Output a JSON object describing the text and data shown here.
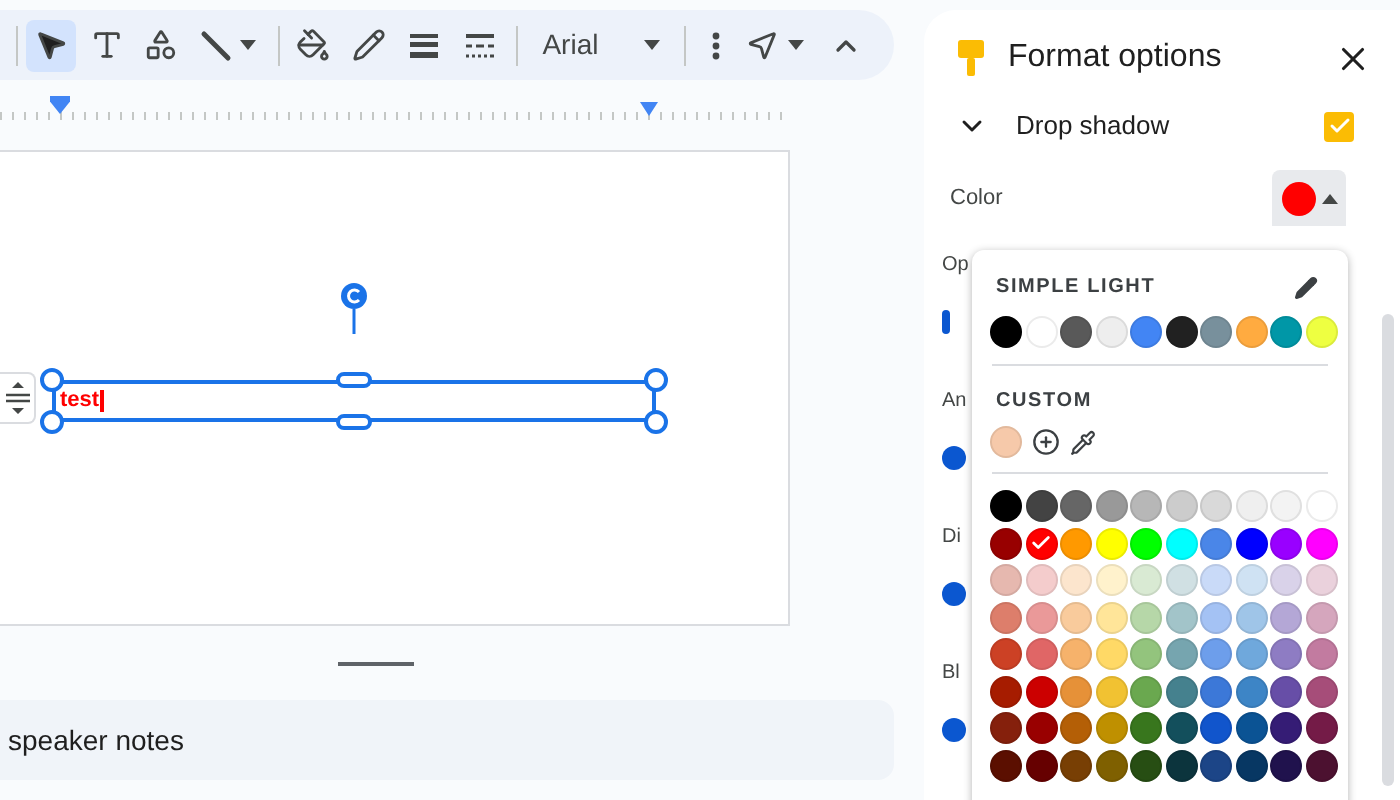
{
  "toolbar": {
    "tools": [
      {
        "kind": "select",
        "selected": true
      },
      {
        "kind": "text",
        "selected": false
      },
      {
        "kind": "shapes",
        "selected": false
      },
      {
        "kind": "line",
        "selected": false
      },
      {
        "kind": "fill",
        "selected": false
      },
      {
        "kind": "pen",
        "selected": false
      },
      {
        "kind": "weight",
        "selected": false
      },
      {
        "kind": "dash",
        "selected": false
      }
    ],
    "font": "Arial"
  },
  "slide": {
    "textbox": "test"
  },
  "notes": "speaker notes",
  "panel": {
    "title": "Format options",
    "section": {
      "label": "Drop shadow",
      "expanded": true,
      "checked": true
    },
    "color_label": "Color",
    "color": "#ff0000",
    "covered_labels": [
      "Op",
      "An",
      "Di",
      "Bl"
    ],
    "popup": {
      "simple_title": "SIMPLE LIGHT",
      "simple": [
        {
          "color": "#000000",
          "selected": false
        },
        {
          "color": "#ffffff",
          "selected": false
        },
        {
          "color": "#595959",
          "selected": false
        },
        {
          "color": "#eeeeee",
          "selected": false
        },
        {
          "color": "#4285f4",
          "selected": false
        },
        {
          "color": "#212121",
          "selected": false
        },
        {
          "color": "#78909c",
          "selected": false
        },
        {
          "color": "#ffab40",
          "selected": false
        },
        {
          "color": "#0097a7",
          "selected": false
        },
        {
          "color": "#eeff41",
          "selected": false
        }
      ],
      "custom_title": "CUSTOM",
      "custom": [
        {
          "color": "#f6c9aa",
          "selected": false
        }
      ],
      "palette": [
        [
          {
            "color": "#000000",
            "selected": false
          },
          {
            "color": "#434343",
            "selected": false
          },
          {
            "color": "#666666",
            "selected": false
          },
          {
            "color": "#999999",
            "selected": false
          },
          {
            "color": "#b7b7b7",
            "selected": false
          },
          {
            "color": "#cccccc",
            "selected": false
          },
          {
            "color": "#d9d9d9",
            "selected": false
          },
          {
            "color": "#efefef",
            "selected": false
          },
          {
            "color": "#f3f3f3",
            "selected": false
          },
          {
            "color": "#ffffff",
            "selected": false
          }
        ],
        [
          {
            "color": "#980000",
            "selected": false
          },
          {
            "color": "#ff0000",
            "selected": true
          },
          {
            "color": "#ff9900",
            "selected": false
          },
          {
            "color": "#ffff00",
            "selected": false
          },
          {
            "color": "#00ff00",
            "selected": false
          },
          {
            "color": "#00ffff",
            "selected": false
          },
          {
            "color": "#4a86e8",
            "selected": false
          },
          {
            "color": "#0000ff",
            "selected": false
          },
          {
            "color": "#9900ff",
            "selected": false
          },
          {
            "color": "#ff00ff",
            "selected": false
          }
        ],
        [
          {
            "color": "#e6b8af",
            "selected": false
          },
          {
            "color": "#f4cccc",
            "selected": false
          },
          {
            "color": "#fce5cd",
            "selected": false
          },
          {
            "color": "#fff2cc",
            "selected": false
          },
          {
            "color": "#d9ead3",
            "selected": false
          },
          {
            "color": "#d0e0e3",
            "selected": false
          },
          {
            "color": "#c9daf8",
            "selected": false
          },
          {
            "color": "#cfe2f3",
            "selected": false
          },
          {
            "color": "#d9d2e9",
            "selected": false
          },
          {
            "color": "#ead1dc",
            "selected": false
          }
        ],
        [
          {
            "color": "#dd7e6b",
            "selected": false
          },
          {
            "color": "#ea9999",
            "selected": false
          },
          {
            "color": "#f9cb9c",
            "selected": false
          },
          {
            "color": "#ffe599",
            "selected": false
          },
          {
            "color": "#b6d7a8",
            "selected": false
          },
          {
            "color": "#a2c4c9",
            "selected": false
          },
          {
            "color": "#a4c2f4",
            "selected": false
          },
          {
            "color": "#9fc5e8",
            "selected": false
          },
          {
            "color": "#b4a7d6",
            "selected": false
          },
          {
            "color": "#d5a6bd",
            "selected": false
          }
        ],
        [
          {
            "color": "#cc4125",
            "selected": false
          },
          {
            "color": "#e06666",
            "selected": false
          },
          {
            "color": "#f6b26b",
            "selected": false
          },
          {
            "color": "#ffd966",
            "selected": false
          },
          {
            "color": "#93c47d",
            "selected": false
          },
          {
            "color": "#76a5af",
            "selected": false
          },
          {
            "color": "#6d9eeb",
            "selected": false
          },
          {
            "color": "#6fa8dc",
            "selected": false
          },
          {
            "color": "#8e7cc3",
            "selected": false
          },
          {
            "color": "#c27ba0",
            "selected": false
          }
        ],
        [
          {
            "color": "#a61c00",
            "selected": false
          },
          {
            "color": "#cc0000",
            "selected": false
          },
          {
            "color": "#e69138",
            "selected": false
          },
          {
            "color": "#f1c232",
            "selected": false
          },
          {
            "color": "#6aa84f",
            "selected": false
          },
          {
            "color": "#45818e",
            "selected": false
          },
          {
            "color": "#3c78d8",
            "selected": false
          },
          {
            "color": "#3d85c6",
            "selected": false
          },
          {
            "color": "#674ea7",
            "selected": false
          },
          {
            "color": "#a64d79",
            "selected": false
          }
        ],
        [
          {
            "color": "#85200c",
            "selected": false
          },
          {
            "color": "#990000",
            "selected": false
          },
          {
            "color": "#b45f06",
            "selected": false
          },
          {
            "color": "#bf9000",
            "selected": false
          },
          {
            "color": "#38761d",
            "selected": false
          },
          {
            "color": "#134f5c",
            "selected": false
          },
          {
            "color": "#1155cc",
            "selected": false
          },
          {
            "color": "#0b5394",
            "selected": false
          },
          {
            "color": "#351c75",
            "selected": false
          },
          {
            "color": "#741b47",
            "selected": false
          }
        ],
        [
          {
            "color": "#5b0f00",
            "selected": false
          },
          {
            "color": "#660000",
            "selected": false
          },
          {
            "color": "#783f04",
            "selected": false
          },
          {
            "color": "#7f6000",
            "selected": false
          },
          {
            "color": "#274e13",
            "selected": false
          },
          {
            "color": "#0c343d",
            "selected": false
          },
          {
            "color": "#1c4587",
            "selected": false
          },
          {
            "color": "#073763",
            "selected": false
          },
          {
            "color": "#20124d",
            "selected": false
          },
          {
            "color": "#4c1130",
            "selected": false
          }
        ]
      ]
    }
  }
}
